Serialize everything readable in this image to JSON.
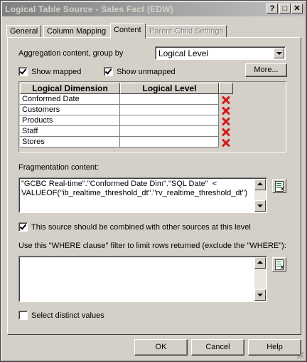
{
  "window": {
    "title": "Logical Table Source - Sales Fact (EDW)",
    "controls": {
      "help": "?",
      "maximize": "□",
      "close": "✕"
    }
  },
  "tabs": [
    {
      "label": "General",
      "active": false,
      "enabled": true
    },
    {
      "label": "Column Mapping",
      "active": false,
      "enabled": true
    },
    {
      "label": "Content",
      "active": true,
      "enabled": true
    },
    {
      "label": "Parent-Child Settings",
      "active": false,
      "enabled": false
    }
  ],
  "content": {
    "aggregation_label": "Aggregation content, group by",
    "aggregation_value": "Logical Level",
    "show_mapped_label": "Show mapped",
    "show_mapped_checked": true,
    "show_unmapped_label": "Show unmapped",
    "show_unmapped_checked": true,
    "more_button": "More...",
    "grid": {
      "columns": [
        "Logical Dimension",
        "Logical Level"
      ],
      "rows": [
        {
          "dimension": "Conformed Date",
          "level": ""
        },
        {
          "dimension": "Customers",
          "level": ""
        },
        {
          "dimension": "Products",
          "level": ""
        },
        {
          "dimension": "Staff",
          "level": ""
        },
        {
          "dimension": "Stores",
          "level": ""
        }
      ],
      "delete_icon": "red-x-delete-icon"
    },
    "fragmentation_label": "Fragmentation content:",
    "fragmentation_value": "\"GCBC Real-time\".\"Conformed Date Dim\".\"SQL Date\"  <\nVALUEOF(\"ib_realtime_threshold_dt\".\"rv_realtime_threshold_dt\")",
    "combine_label": "This source should be combined with other sources at this level",
    "combine_checked": true,
    "where_label": "Use this \"WHERE clause\" filter to limit rows returned (exclude the \"WHERE\"):",
    "where_value": "",
    "distinct_label": "Select distinct values",
    "distinct_checked": false,
    "expression_icon": "expression-builder-icon"
  },
  "buttons": {
    "ok": "OK",
    "cancel": "Cancel",
    "help": "Help"
  }
}
